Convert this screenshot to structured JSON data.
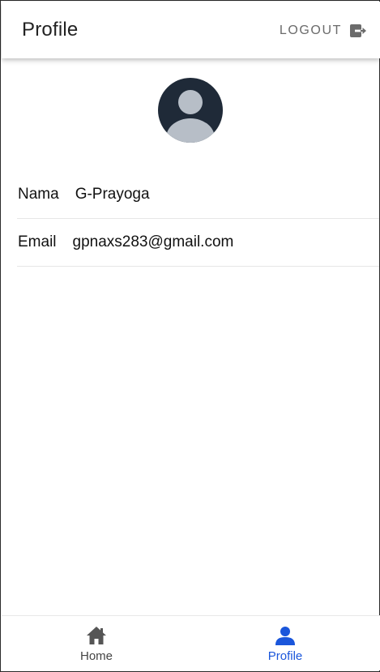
{
  "appbar": {
    "title": "Profile",
    "logout_label": "LOGOUT",
    "logout_icon": "logout-icon"
  },
  "profile": {
    "avatar_icon": "user-avatar-icon",
    "fields": [
      {
        "label": "Nama",
        "value": "G-Prayoga"
      },
      {
        "label": "Email",
        "value": "gpnaxs283@gmail.com"
      }
    ]
  },
  "bottom_nav": {
    "items": [
      {
        "label": "Home",
        "icon": "home-icon",
        "active": false
      },
      {
        "label": "Profile",
        "icon": "person-icon",
        "active": true
      }
    ]
  },
  "colors": {
    "accent": "#1a56db",
    "avatar_bg": "#1f2a38",
    "avatar_fg": "#b7bec7",
    "muted": "#6b6b6b"
  }
}
